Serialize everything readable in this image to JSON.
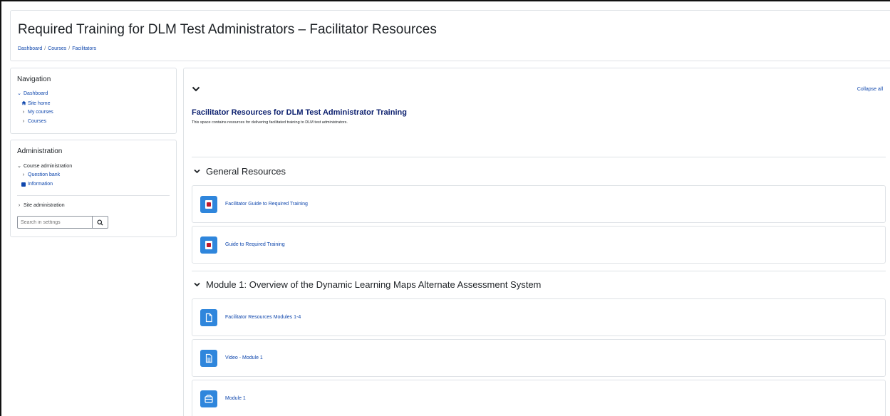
{
  "page": {
    "title": "Required Training for DLM Test Administrators – Facilitator Resources",
    "breadcrumb": [
      "Dashboard",
      "Courses",
      "Facilitators"
    ],
    "breadcrumb_separator": "/"
  },
  "navigation": {
    "title": "Navigation",
    "items": [
      {
        "label": "Dashboard",
        "icon": "chevron-down-icon"
      },
      {
        "label": "Site home",
        "icon": "home-icon"
      },
      {
        "label": "My courses",
        "icon": "chevron-right-icon"
      },
      {
        "label": "Courses",
        "icon": "chevron-right-icon"
      }
    ]
  },
  "administration": {
    "title": "Administration",
    "items": [
      {
        "label": "Course administration",
        "icon": "chevron-down-icon"
      },
      {
        "label": "Question bank",
        "icon": "chevron-right-icon"
      },
      {
        "label": "Information",
        "icon": "info-square-icon"
      },
      {
        "label": "Site administration",
        "icon": "chevron-right-icon"
      }
    ],
    "search_placeholder": "Search in settings"
  },
  "main": {
    "collapse_all": "Collapse all",
    "summary_heading": "Facilitator Resources for DLM Test Administrator Training",
    "summary_text": "This space contains resources for delivering facilitated training to DLM test administrators.",
    "sections": [
      {
        "name": "General Resources",
        "activities": [
          {
            "label": "Facilitator Guide to Required Training",
            "icon": "pdf-icon"
          },
          {
            "label": "Guide to Required Training",
            "icon": "pdf-icon"
          }
        ]
      },
      {
        "name": "Module 1: Overview of the Dynamic Learning Maps Alternate Assessment System",
        "activities": [
          {
            "label": "Facilitator Resources Modules 1-4",
            "icon": "file-icon"
          },
          {
            "label": "Video - Module 1",
            "icon": "page-icon"
          },
          {
            "label": "Module 1",
            "icon": "package-icon"
          }
        ]
      }
    ]
  },
  "colors": {
    "link": "#0f47ad",
    "heading_navy": "#0b1f6e",
    "activity_icon_bg": "#2f86dc",
    "pdf_red": "#c0182b",
    "border": "#dee2e6"
  }
}
